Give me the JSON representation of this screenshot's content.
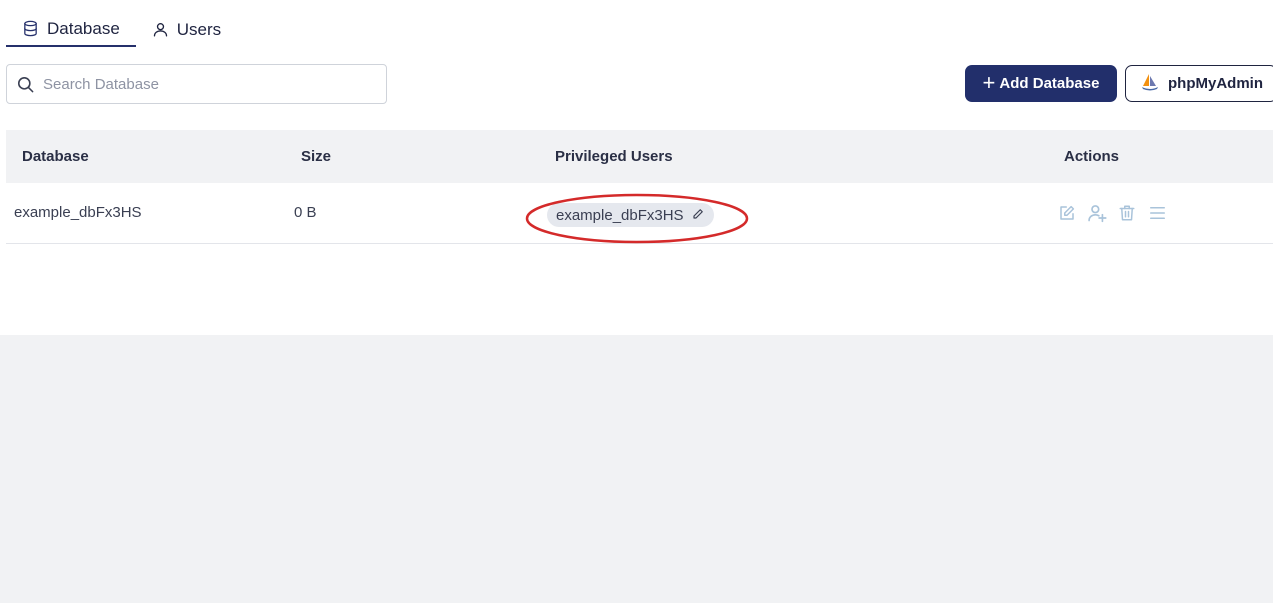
{
  "tabs": [
    {
      "label": "Database",
      "icon": "database-icon",
      "active": true
    },
    {
      "label": "Users",
      "icon": "user-icon",
      "active": false
    }
  ],
  "search": {
    "placeholder": "Search Database",
    "value": ""
  },
  "toolbar": {
    "add_label": "Add Database",
    "add_icon": "plus-icon",
    "pma_label": "phpMyAdmin",
    "pma_icon": "phpmyadmin-logo"
  },
  "table": {
    "columns": [
      "Database",
      "Size",
      "Privileged Users",
      "Actions"
    ],
    "rows": [
      {
        "database": "example_dbFx3HS",
        "size": "0 B",
        "user": "example_dbFx3HS",
        "user_icon": "pencil-icon",
        "actions": [
          "edit-icon",
          "add-user-icon",
          "trash-icon",
          "menu-icon"
        ]
      }
    ]
  },
  "colors": {
    "primary": "#222f6b",
    "annotation": "#d42a2a",
    "action_icon": "#a9c3da",
    "chip_bg": "#e5e8ee",
    "header_bg": "#f1f2f4"
  }
}
